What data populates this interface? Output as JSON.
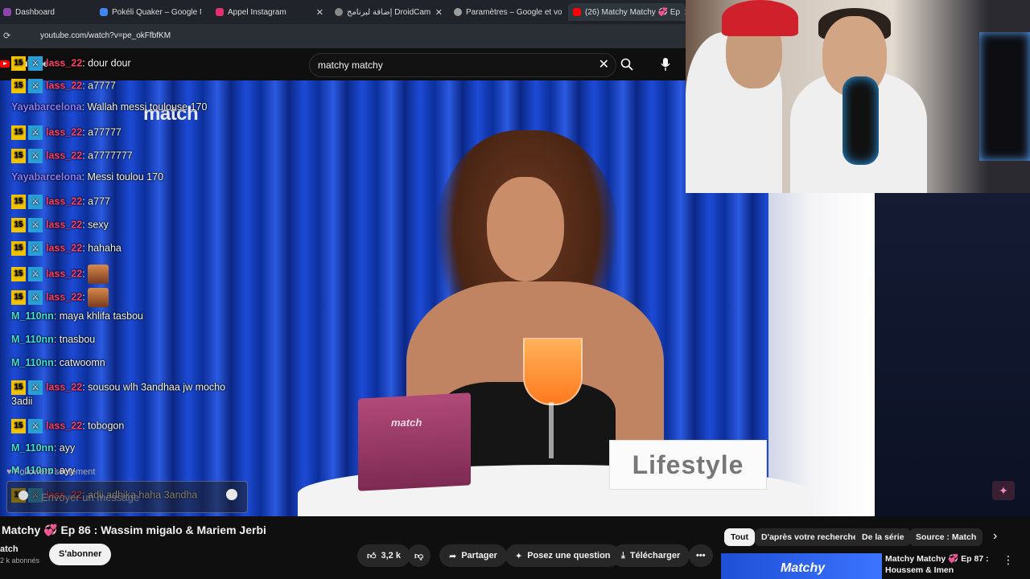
{
  "browser": {
    "tabs": [
      {
        "label": "Dashboard",
        "color": "#8e44ad"
      },
      {
        "label": "Pokéli Quaker – Google M",
        "color": "#4285f4"
      },
      {
        "label": "Appel Instagram",
        "color": "#e1306c"
      },
      {
        "label": "إضافة لبرنامج DroidCam",
        "color": "#888888"
      },
      {
        "label": "Paramètres – Google et vo",
        "color": "#9e9e9e"
      },
      {
        "label": "(26) Matchy Matchy 💞 Ep",
        "color": "#ff0000"
      }
    ],
    "url": "youtube.com/watch?v=pe_okFfbfKM"
  },
  "youtube": {
    "logo_text": "YouTube",
    "search_query": "matchy matchy"
  },
  "video": {
    "brand_logo": "match",
    "box_label": "match",
    "card_text": "Lifestyle"
  },
  "chat": {
    "messages": [
      {
        "user": "lass_22",
        "text": "dour dour",
        "color": "#ff3b6b",
        "badges": true
      },
      {
        "user": "lass_22",
        "text": "a7777",
        "color": "#ff3b6b",
        "badges": true
      },
      {
        "user": "Yayabarcelona",
        "text": "Wallah messi toulouse 170",
        "color": "#8a7cff",
        "badges": false
      },
      {
        "user": "lass_22",
        "text": "a77777",
        "color": "#ff3b6b",
        "badges": true
      },
      {
        "user": "lass_22",
        "text": "a7777777",
        "color": "#ff3b6b",
        "badges": true
      },
      {
        "user": "Yayabarcelona",
        "text": "Messi toulou 170",
        "color": "#8a7cff",
        "badges": false
      },
      {
        "user": "lass_22",
        "text": "a777",
        "color": "#ff3b6b",
        "badges": true
      },
      {
        "user": "lass_22",
        "text": "sexy",
        "color": "#ff3b6b",
        "badges": true
      },
      {
        "user": "lass_22",
        "text": "hahaha",
        "color": "#ff3b6b",
        "badges": true
      },
      {
        "user": "lass_22",
        "text": "",
        "color": "#ff3b6b",
        "badges": true,
        "emote": true
      },
      {
        "user": "lass_22",
        "text": "",
        "color": "#ff3b6b",
        "badges": true,
        "emote": true
      },
      {
        "user": "M_110nn",
        "text": "maya khlifa tasbou",
        "color": "#3ee0d0",
        "badges": false
      },
      {
        "user": "M_110nn",
        "text": "tnasbou",
        "color": "#3ee0d0",
        "badges": false
      },
      {
        "user": "M_110nn",
        "text": "catwoomn",
        "color": "#3ee0d0",
        "badges": false
      },
      {
        "user": "lass_22",
        "text": "sousou wlh 3andhaa jw mocho",
        "color": "#ff3b6b",
        "badges": true
      },
      {
        "user": "",
        "text": "3adii",
        "color": "#ff3b6b",
        "badges": false
      },
      {
        "user": "lass_22",
        "text": "tobogon",
        "color": "#ff3b6b",
        "badges": true
      },
      {
        "user": "M_110nn",
        "text": "ayy",
        "color": "#3ee0d0",
        "badges": false
      },
      {
        "user": "M_110nn",
        "text": "ayy",
        "color": "#3ee0d0",
        "badges": false
      },
      {
        "user": "lass_22",
        "text": "adii adhika haha 3andha",
        "color": "#ff3b6b",
        "badges": true
      }
    ],
    "badge_text": "15",
    "followers_only": "Followers seulement",
    "input_placeholder": "Envoyer un message"
  },
  "watch": {
    "title": "Matchy 💞 Ep 86 : Wassim migalo & Mariem Jerbi",
    "channel": "atch",
    "subscribers": "2 k abonnés",
    "subscribe_label": "S'abonner",
    "like_count": "3,2 k",
    "share_label": "Partager",
    "ask_label": "Posez une question",
    "download_label": "Télécharger"
  },
  "chips": [
    "Tout",
    "D'après votre recherche",
    "De la série",
    "Source : Match"
  ],
  "recommendation": {
    "thumb_text": "Matchy",
    "title": "Matchy Matchy 💞 Ep 87 : Houssem & Imen"
  }
}
